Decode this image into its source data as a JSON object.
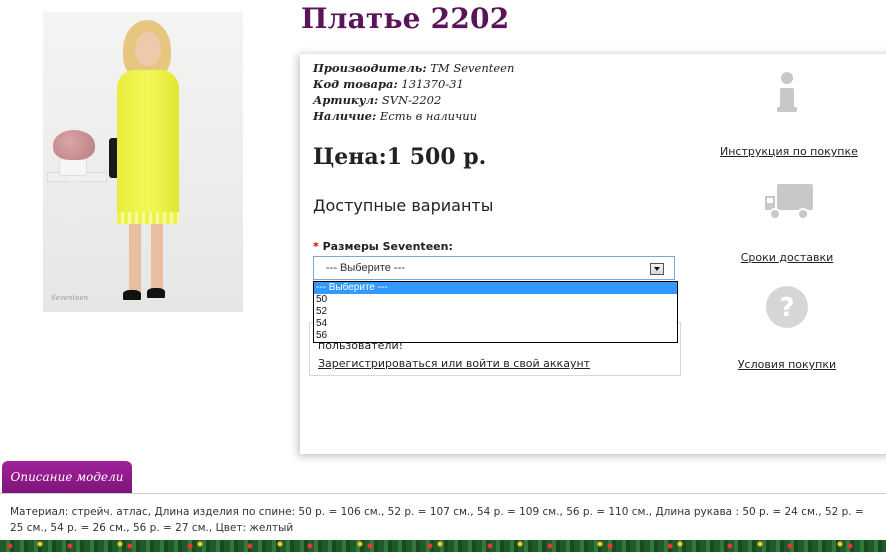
{
  "product": {
    "title": "Платье 2202",
    "meta": [
      {
        "label": "Производитель:",
        "value": "ТМ Seventeen"
      },
      {
        "label": "Код товара:",
        "value": "131370-31"
      },
      {
        "label": "Артикул:",
        "value": "SVN-2202"
      },
      {
        "label": "Наличие:",
        "value": "Есть в наличии"
      }
    ],
    "price": "Цена:1 500 р.",
    "variants_heading": "Доступные варианты",
    "size_label_required": "*",
    "size_label": "Размеры Seventeen:",
    "select_value": "--- Выберите ---",
    "options": [
      "--- Выберите ---",
      "50",
      "52",
      "54",
      "56"
    ],
    "notice_text": "пользователи!",
    "notice_link": "Зарегистрироваться или войти в свой аккаунт",
    "image_signature": "Seventeen"
  },
  "side": {
    "instruction": "Инструкция по покупке",
    "delivery": "Сроки доставки",
    "conditions": "Условия покупки"
  },
  "tabs": {
    "description_tab": "Описание модели",
    "description_text": "Материал: стрейч. атлас, Длина изделия по спине: 50 р. = 106 см., 52 р. = 107 см., 54 р. = 109 см., 56 р. = 110 см., Длина рукава : 50 р. = 24 см., 52 р. = 25 см., 54 р. = 26 см., 56 р. = 27 см., Цвет: желтый"
  },
  "colors": {
    "title": "#5a1457",
    "tab": "#8e1a8a",
    "select_highlight": "#3399ff"
  },
  "icons": [
    "info-icon",
    "truck-icon",
    "question-icon"
  ]
}
